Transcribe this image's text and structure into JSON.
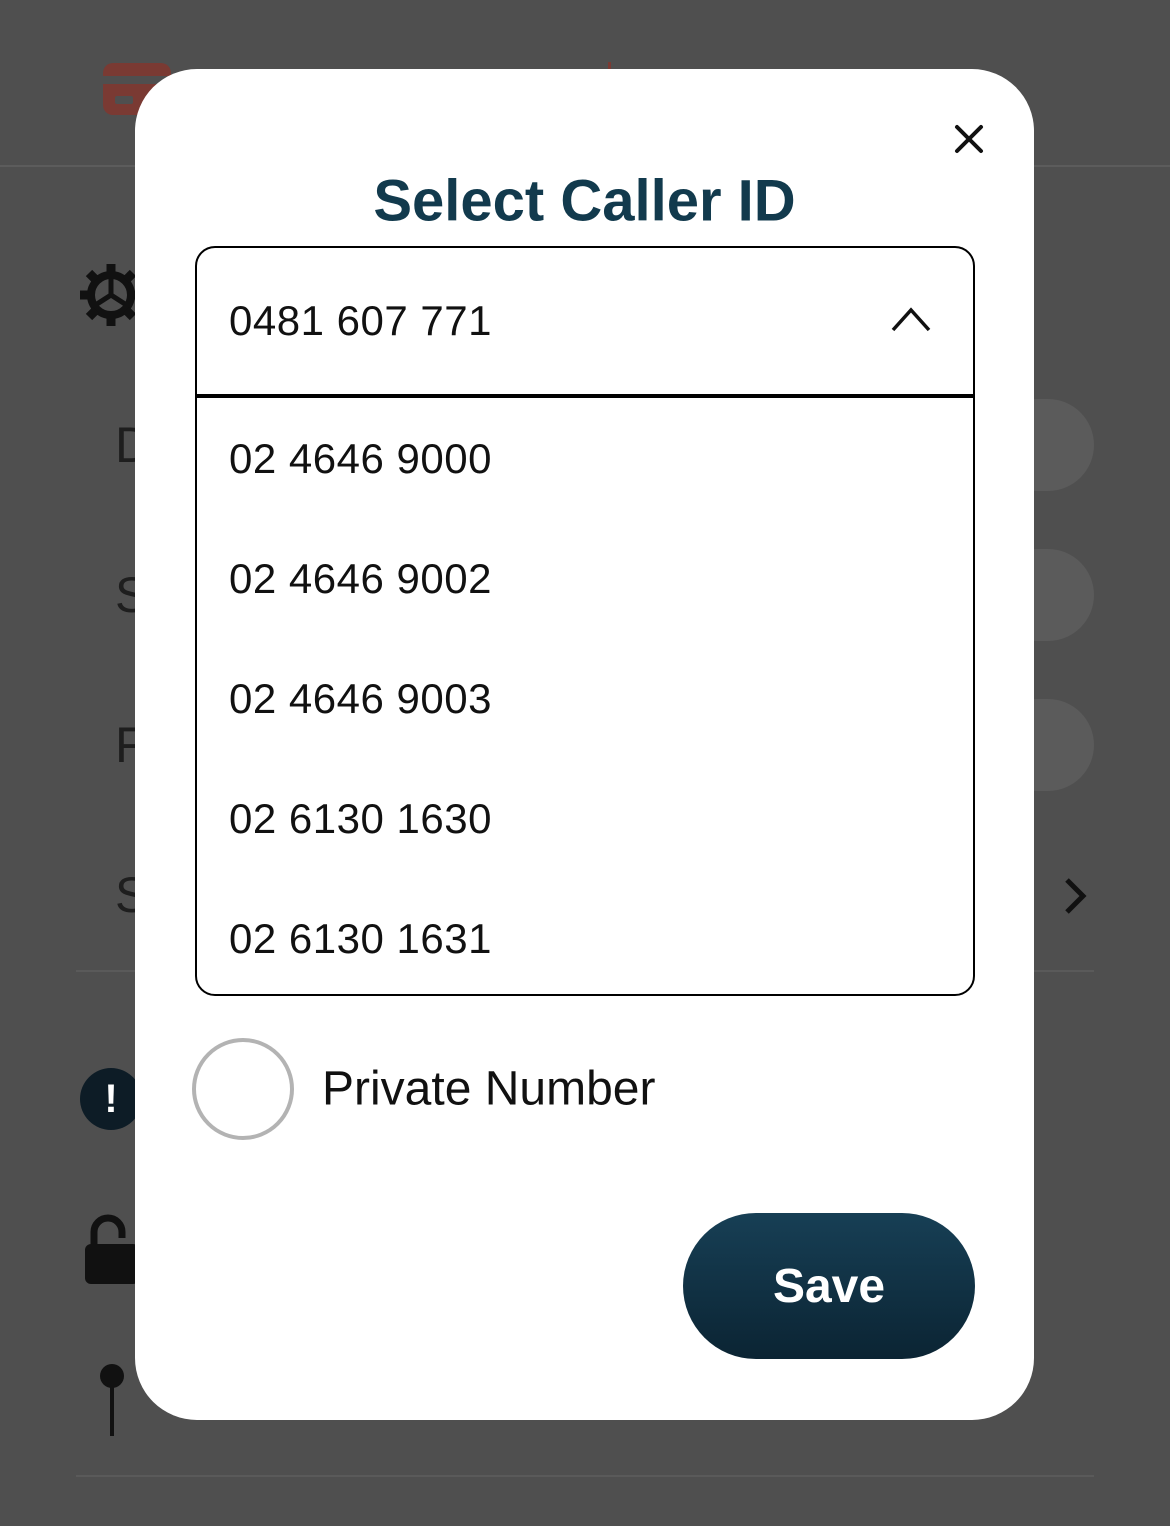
{
  "dialog": {
    "title": "Select Caller ID",
    "selected_caller_id": "0481 607 771",
    "dropdown_expanded": true,
    "options": [
      "02 4646 9000",
      "02 4646 9002",
      "02 4646 9003",
      "02 6130 1630",
      "02 6130 1631"
    ],
    "private_number_label": "Private Number",
    "private_number_checked": false,
    "save_label": "Save",
    "close_icon": "close-icon",
    "dropdown_icon": "chevron-up-icon"
  },
  "background": {
    "row_initials": [
      "D",
      "S",
      "F",
      "S"
    ],
    "icons": [
      "credit-card-icon",
      "gear-icon",
      "alert-icon",
      "lock-icon",
      "pin-icon",
      "chevron-right-icon"
    ],
    "accent_color": "#7a3a33",
    "overlay_color": "#4f4f4f"
  },
  "colors": {
    "title": "#123a4d",
    "save_button": "#0f2f40"
  }
}
